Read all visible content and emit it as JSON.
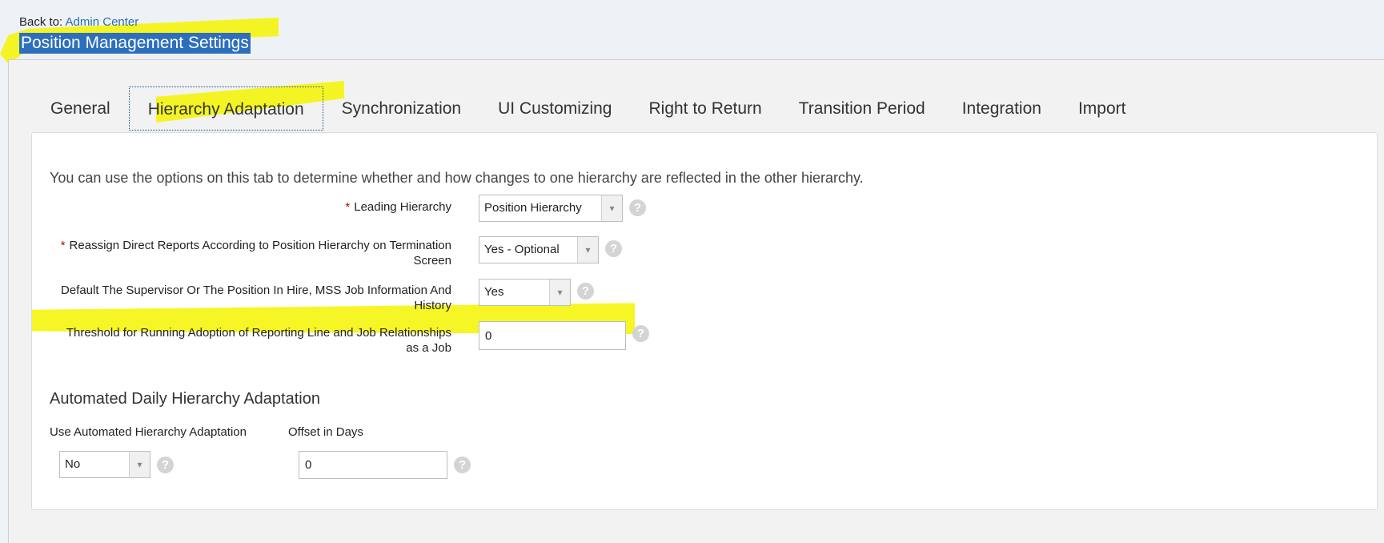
{
  "header": {
    "back_prefix": "Back to:",
    "back_link": "Admin Center",
    "page_title": "Position Management Settings"
  },
  "tabs": [
    {
      "label": "General"
    },
    {
      "label": "Hierarchy Adaptation",
      "active": true
    },
    {
      "label": "Synchronization"
    },
    {
      "label": "UI Customizing"
    },
    {
      "label": "Right to Return"
    },
    {
      "label": "Transition Period"
    },
    {
      "label": "Integration"
    },
    {
      "label": "Import"
    }
  ],
  "content": {
    "intro": "You can use the options on this tab to determine whether and how changes to one hierarchy are reflected in the other hierarchy.",
    "fields": {
      "leading_hierarchy": {
        "label": "Leading Hierarchy",
        "required": "*",
        "value": "Position Hierarchy"
      },
      "reassign": {
        "label_line1": "Reassign Direct Reports According to Position Hierarchy on Termination",
        "label_line2": "Screen",
        "required": "*",
        "value": "Yes - Optional"
      },
      "default_supervisor": {
        "label_line1": "Default The Supervisor Or The Position In Hire, MSS Job Information And",
        "label_line2": "History",
        "value": "Yes"
      },
      "threshold": {
        "label_line1": "Threshold for Running Adoption of Reporting Line and Job Relationships",
        "label_line2": "as a Job",
        "value": "0"
      }
    },
    "automated": {
      "section_title": "Automated Daily Hierarchy Adaptation",
      "use_label": "Use Automated Hierarchy Adaptation",
      "use_value": "No",
      "offset_label": "Offset in Days",
      "offset_value": "0"
    }
  },
  "icons": {
    "help": "?",
    "dropdown": "▾"
  },
  "colors": {
    "highlight": "#f4f400",
    "link": "#2a6db8",
    "title_bg": "#2e6fbd",
    "required": "#c00000"
  }
}
